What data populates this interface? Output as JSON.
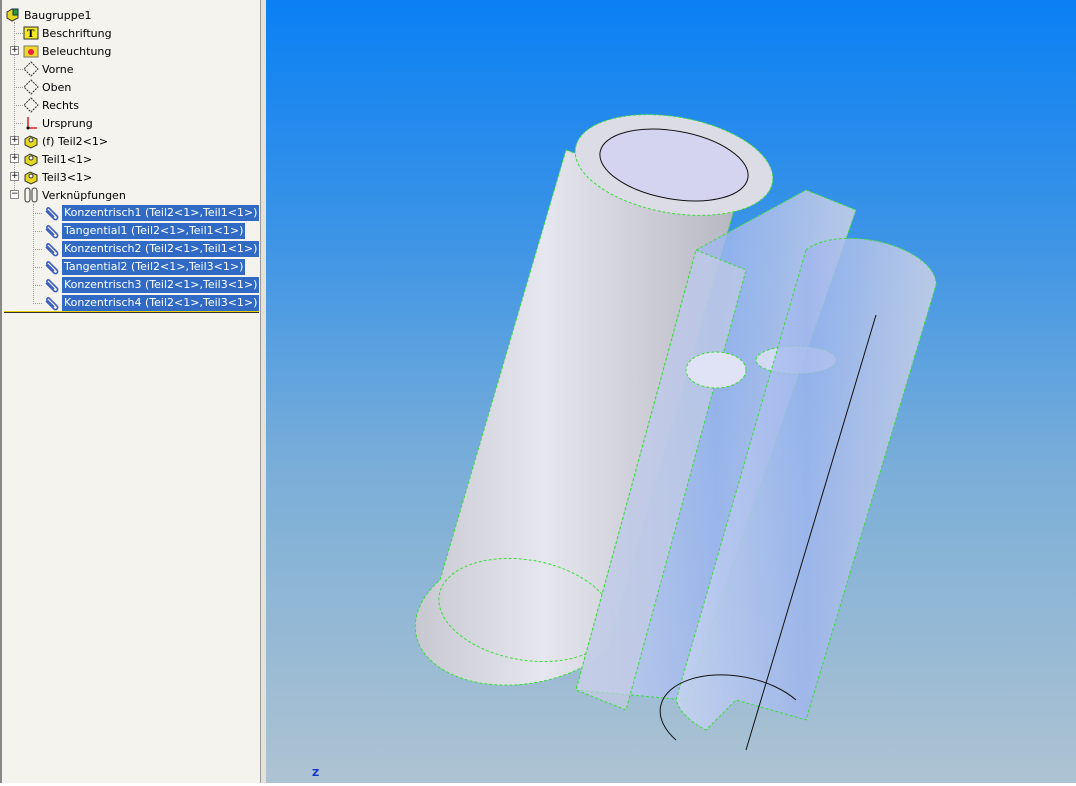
{
  "tree": {
    "root": "Baugruppe1",
    "items": [
      {
        "label": "Beschriftung",
        "icon": "annotation-icon"
      },
      {
        "label": "Beleuchtung",
        "icon": "lighting-icon",
        "expander": "+"
      },
      {
        "label": "Vorne",
        "icon": "plane-icon"
      },
      {
        "label": "Oben",
        "icon": "plane-icon"
      },
      {
        "label": "Rechts",
        "icon": "plane-icon"
      },
      {
        "label": "Ursprung",
        "icon": "origin-icon"
      },
      {
        "label": "(f) Teil2<1>",
        "icon": "part-icon",
        "expander": "+"
      },
      {
        "label": "Teil1<1>",
        "icon": "part-icon",
        "expander": "+"
      },
      {
        "label": "Teil3<1>",
        "icon": "part-icon",
        "expander": "+"
      },
      {
        "label": "Verknüpfungen",
        "icon": "mates-icon",
        "expander": "−"
      }
    ],
    "mates": [
      "Konzentrisch1 (Teil2<1>,Teil1<1>)",
      "Tangential1 (Teil2<1>,Teil1<1>)",
      "Konzentrisch2 (Teil2<1>,Teil1<1>)",
      "Tangential2 (Teil2<1>,Teil3<1>)",
      "Konzentrisch3 (Teil2<1>,Teil3<1>)",
      "Konzentrisch4 (Teil2<1>,Teil3<1>)"
    ]
  },
  "viewport": {
    "triad_label": "Z"
  },
  "colors": {
    "selection": "#316ac5",
    "edge_highlight": "#3ddc3d"
  }
}
